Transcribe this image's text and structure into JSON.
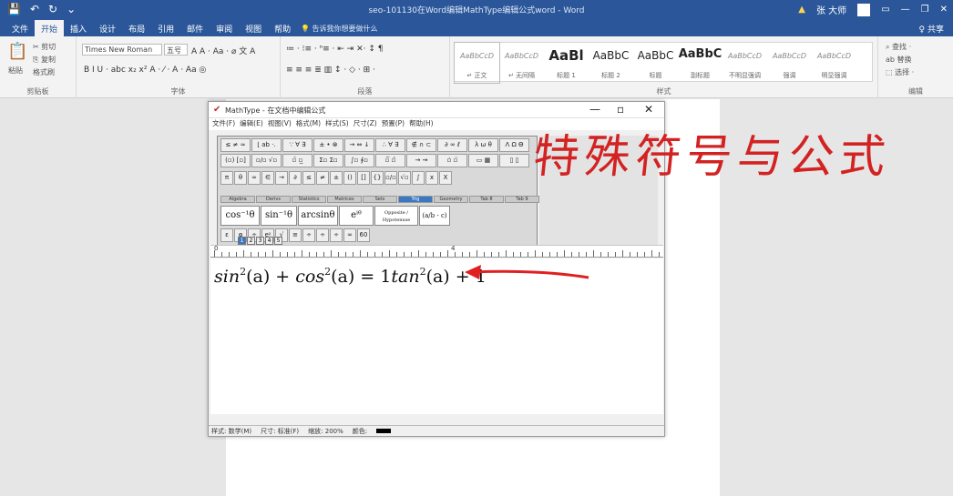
{
  "window": {
    "title": "seo-101130在Word编辑MathType编辑公式word - Word",
    "qat": [
      "💾",
      "↶",
      "↻",
      "⌄"
    ],
    "user": "张 大师",
    "controls": [
      "—",
      "❐",
      "✕"
    ],
    "warning": "▲"
  },
  "ribbon_tabs": [
    "文件",
    "开始",
    "插入",
    "设计",
    "布局",
    "引用",
    "邮件",
    "审阅",
    "视图",
    "帮助"
  ],
  "active_tab": 1,
  "tellme": "告诉我你想要做什么",
  "share": "♀ 共享",
  "clipboard": {
    "paste": "粘贴",
    "cut": "✂ 剪切",
    "copy": "⎘ 复制",
    "painter": "格式刷",
    "label": "剪贴板"
  },
  "font": {
    "name": "Times New Roman",
    "size": "五号",
    "label": "字体",
    "row2": "B  I  U · abc  x₂  x²  A · ⁄ · A · Aa ◎",
    "row1b": "A A · Aa · ⌀ 文 A"
  },
  "paragraph": {
    "label": "段落",
    "row1": "≔ · ⁝≡ · ⁿ≡ ·  ⇤  ⇥  ✕·  ↕  ¶",
    "row2": "≡  ≡  ≡  ≣  ▥  ↕ ·  ◇ ·  ⊞ ·"
  },
  "styles": {
    "label": "样式",
    "items": [
      {
        "preview": "AaBbCcD",
        "name": "↵ 正文",
        "cls": "it"
      },
      {
        "preview": "AaBbCcD",
        "name": "↵ 无间隔",
        "cls": "it"
      },
      {
        "preview": "AaBl",
        "name": "标题 1",
        "cls": "big"
      },
      {
        "preview": "AaBbC",
        "name": "标题 2",
        "cls": "mid"
      },
      {
        "preview": "AaBbC",
        "name": "标题",
        "cls": "mid"
      },
      {
        "preview": "AaBbC",
        "name": "副标题",
        "cls": "big"
      },
      {
        "preview": "AaBbCcD",
        "name": "不明显强调",
        "cls": "it"
      },
      {
        "preview": "AaBbCcD",
        "name": "强调",
        "cls": "it"
      },
      {
        "preview": "AaBbCcD",
        "name": "明显强调",
        "cls": "it"
      }
    ]
  },
  "editing": {
    "find": "⌕ 查找 ·",
    "replace": "ab 替换",
    "select": "⬚ 选择 ·",
    "label": "编辑"
  },
  "mathtype": {
    "title": "MathType - 在文档中编辑公式",
    "menu": [
      "文件(F)",
      "编辑(E)",
      "视图(V)",
      "格式(M)",
      "样式(S)",
      "尺寸(Z)",
      "预置(P)",
      "帮助(H)"
    ],
    "palette_row1": [
      "≤ ≠ ≈",
      "⌊ ab ·.",
      "∵ ∀ ∃",
      "± • ⊗",
      "→ ⇔ ↓",
      "∴ ∀ ∃",
      "∉ ∩ ⊂",
      "∂ ∞ ℓ",
      "λ ω θ",
      "Λ Ω Θ"
    ],
    "palette_row2": [
      "(▫) [▫]",
      "▫/▫ √▫",
      "▫̄ ▫̲",
      "Σ▫ Σ▫",
      "∫▫ ∮▫",
      "▫̅ ▫̂",
      "→ ⇝",
      "▫̇ ▫̈",
      "▭ ▦",
      "▯ ▯"
    ],
    "palette_row3": [
      "π",
      "θ",
      "∞",
      "∈",
      "→",
      "∂",
      "≤",
      "≠",
      "±",
      "()",
      "[]",
      "{}",
      "▫/▫",
      "√▫",
      "∫",
      "x",
      "X"
    ],
    "tabs": [
      "Algebra",
      "Derivs",
      "Statistics",
      "Matrices",
      "Sets",
      "Trig",
      "Geometry",
      "Tab 8",
      "Tab 9"
    ],
    "templates": [
      "cos⁻¹θ",
      "sin⁻¹θ",
      "arcsinθ",
      "eⁱᶿ",
      "Opposite / Hypotenuse",
      "(a/b - c)"
    ],
    "palette_row5": [
      "ε",
      "φ",
      "÷",
      "eᵡ",
      "√",
      "≡",
      "÷",
      "÷",
      "÷",
      "∞",
      "60"
    ],
    "sizes": [
      "1",
      "2",
      "3",
      "4",
      "5"
    ],
    "ruler_marks": [
      "0",
      "4"
    ],
    "equation": {
      "t1": "sin",
      "e1": "2",
      "t2": "(a)",
      "op1": "+",
      "t3": "cos",
      "e2": "2",
      "t4": "(a)",
      "op2": "=",
      "t5": "1",
      "t6": "tan",
      "e3": "2",
      "t7": "(a)",
      "op3": "+",
      "t8": "1"
    },
    "status": [
      "样式: 数学(M)",
      "尺寸: 标准(F)",
      "缩放: 200%",
      "颜色:"
    ]
  },
  "annotation": "特殊符号与公式",
  "colors": {
    "accent": "#2b579a",
    "annotation": "#d32222",
    "arrow": "#e02020"
  }
}
